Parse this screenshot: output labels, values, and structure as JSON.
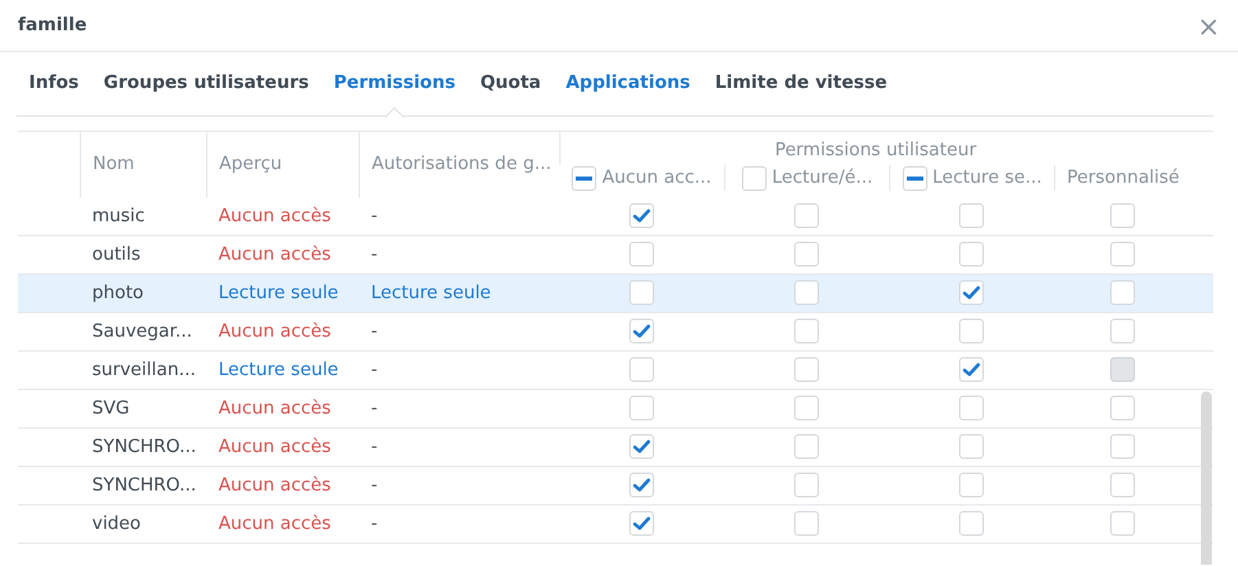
{
  "window": {
    "title": "famille",
    "close": "×"
  },
  "tabs": [
    {
      "label": "Infos",
      "selected": false,
      "hovered": false
    },
    {
      "label": "Groupes utilisateurs",
      "selected": false,
      "hovered": false
    },
    {
      "label": "Permissions",
      "selected": true,
      "hovered": false
    },
    {
      "label": "Quota",
      "selected": false,
      "hovered": false
    },
    {
      "label": "Applications",
      "selected": false,
      "hovered": true
    },
    {
      "label": "Limite de vitesse",
      "selected": false,
      "hovered": false
    }
  ],
  "table": {
    "columns": [
      "Nom",
      "Aperçu",
      "Autorisations de g..."
    ],
    "group_title": "Permissions utilisateur",
    "permission_columns": [
      {
        "label": "Aucun acc...",
        "kind": "mixed"
      },
      {
        "label": "Lecture/é...",
        "kind": "unchecked"
      },
      {
        "label": "Lecture se...",
        "kind": "mixed"
      },
      {
        "label": "Personnalisé",
        "kind": "none"
      }
    ],
    "rows": [
      {
        "name": "music",
        "preview": {
          "text": "Aucun accès",
          "color": "#d9534f"
        },
        "group": {
          "text": "-",
          "color": "#555555"
        },
        "selected": false,
        "perms": [
          {
            "checked": true,
            "disabled": false
          },
          {
            "checked": false,
            "disabled": false
          },
          {
            "checked": false,
            "disabled": false
          },
          {
            "checked": false,
            "disabled": false
          }
        ]
      },
      {
        "name": "outils",
        "preview": {
          "text": "Aucun accès",
          "color": "#d9534f"
        },
        "group": {
          "text": "-",
          "color": "#555555"
        },
        "selected": false,
        "perms": [
          {
            "checked": false,
            "disabled": false
          },
          {
            "checked": false,
            "disabled": false
          },
          {
            "checked": false,
            "disabled": false
          },
          {
            "checked": false,
            "disabled": false
          }
        ]
      },
      {
        "name": "photo",
        "preview": {
          "text": "Lecture seule",
          "color": "#1e7ad2"
        },
        "group": {
          "text": "Lecture seule",
          "color": "#1e7ad2"
        },
        "selected": true,
        "perms": [
          {
            "checked": false,
            "disabled": false
          },
          {
            "checked": false,
            "disabled": false
          },
          {
            "checked": true,
            "disabled": false
          },
          {
            "checked": false,
            "disabled": false
          }
        ]
      },
      {
        "name": "Sauvegar...",
        "preview": {
          "text": "Aucun accès",
          "color": "#d9534f"
        },
        "group": {
          "text": "-",
          "color": "#555555"
        },
        "selected": false,
        "perms": [
          {
            "checked": true,
            "disabled": false
          },
          {
            "checked": false,
            "disabled": false
          },
          {
            "checked": false,
            "disabled": false
          },
          {
            "checked": false,
            "disabled": false
          }
        ]
      },
      {
        "name": "surveillan...",
        "preview": {
          "text": "Lecture seule",
          "color": "#1e7ad2"
        },
        "group": {
          "text": "-",
          "color": "#555555"
        },
        "selected": false,
        "perms": [
          {
            "checked": false,
            "disabled": false
          },
          {
            "checked": false,
            "disabled": false
          },
          {
            "checked": true,
            "disabled": false
          },
          {
            "checked": false,
            "disabled": true
          }
        ]
      },
      {
        "name": "SVG",
        "preview": {
          "text": "Aucun accès",
          "color": "#d9534f"
        },
        "group": {
          "text": "-",
          "color": "#555555"
        },
        "selected": false,
        "perms": [
          {
            "checked": false,
            "disabled": false
          },
          {
            "checked": false,
            "disabled": false
          },
          {
            "checked": false,
            "disabled": false
          },
          {
            "checked": false,
            "disabled": false
          }
        ]
      },
      {
        "name": "SYNCHRO...",
        "preview": {
          "text": "Aucun accès",
          "color": "#d9534f"
        },
        "group": {
          "text": "-",
          "color": "#555555"
        },
        "selected": false,
        "perms": [
          {
            "checked": true,
            "disabled": false
          },
          {
            "checked": false,
            "disabled": false
          },
          {
            "checked": false,
            "disabled": false
          },
          {
            "checked": false,
            "disabled": false
          }
        ]
      },
      {
        "name": "SYNCHRO...",
        "preview": {
          "text": "Aucun accès",
          "color": "#d9534f"
        },
        "group": {
          "text": "-",
          "color": "#555555"
        },
        "selected": false,
        "perms": [
          {
            "checked": true,
            "disabled": false
          },
          {
            "checked": false,
            "disabled": false
          },
          {
            "checked": false,
            "disabled": false
          },
          {
            "checked": false,
            "disabled": false
          }
        ]
      },
      {
        "name": "video",
        "preview": {
          "text": "Aucun accès",
          "color": "#d9534f"
        },
        "group": {
          "text": "-",
          "color": "#555555"
        },
        "selected": false,
        "perms": [
          {
            "checked": true,
            "disabled": false
          },
          {
            "checked": false,
            "disabled": false
          },
          {
            "checked": false,
            "disabled": false
          },
          {
            "checked": false,
            "disabled": false
          }
        ]
      }
    ]
  }
}
